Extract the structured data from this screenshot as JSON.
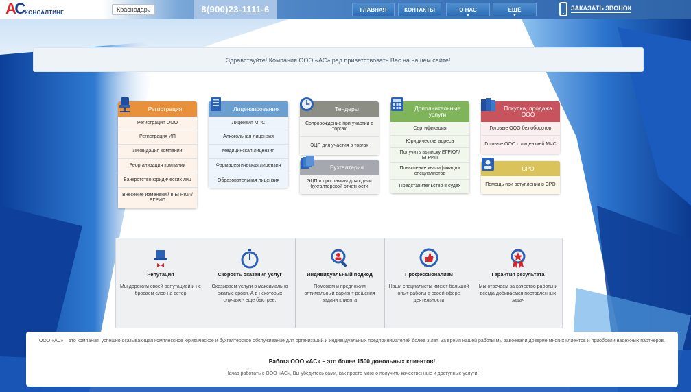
{
  "header": {
    "logo_mark": "АС",
    "logo_text": "КОНСАЛТИНГ",
    "city": "Краснодар",
    "phone": "8(900)23-1111-6",
    "nav": [
      {
        "label": "ГЛАВНАЯ",
        "dropdown": false
      },
      {
        "label": "КОНТАКТЫ",
        "dropdown": false
      },
      {
        "label": "О НАС",
        "dropdown": true
      },
      {
        "label": "ЕЩЁ",
        "dropdown": true
      }
    ],
    "callback_label": "ЗАКАЗАТЬ ЗВОНОК",
    "dropdown_glyph": "▼"
  },
  "welcome_text": "Здравствуйте! Компания ООО «АС» рад приветствовать Вас на нашем сайте!",
  "cards": {
    "registration": {
      "title": "Регистрация",
      "color": "#e8913a",
      "items": [
        "Регистрация ООО",
        "Регистрация ИП",
        "Ликвидация компании",
        "Реорганизация компании",
        "Банкротство юридических лиц",
        "Внесение изменений в ЕГРЮЛ/ЕГРИП"
      ]
    },
    "licensing": {
      "title": "Лицензирование",
      "color": "#6a9fd0",
      "items": [
        "Лицензия МЧС",
        "Алкогольная лицензия",
        "Медицинская лицензия",
        "Фармацевтическая лицензия",
        "Образовательная лицензия"
      ]
    },
    "tenders": {
      "title": "Тендеры",
      "color": "#8c8e85",
      "items": [
        "Сопровождение при участии в торгах",
        "ЭЦП для участия в торгах"
      ]
    },
    "accounting": {
      "title": "Бухгалтерия",
      "color": "#a5a8ae",
      "items": [
        "ЭЦП и программы для сдачи бухгалтерской отчетности"
      ]
    },
    "additional": {
      "title": "Дополнительные услуги",
      "color": "#7fb45a",
      "items": [
        "Сертификация",
        "Юридические адреса",
        "Получить выписку ЕГРЮЛ/ЕГРИП",
        "Повышение квалификации специалистов",
        "Представительство в судах"
      ]
    },
    "sale": {
      "title": "Покупка, продажа ООО",
      "color": "#c7545c",
      "items": [
        "Готовые ООО без оборотов",
        "Готовые ООО с лицензией МЧС"
      ]
    },
    "sro": {
      "title": "СРО",
      "color": "#d9c35a",
      "items": [
        "Помощь при вступлении в СРО"
      ]
    }
  },
  "features": [
    {
      "title": "Репутация",
      "text": "Мы дорожим своей репутацией и не бросаем слов на ветер",
      "icon": "top-hat-icon"
    },
    {
      "title": "Скорость оказания услуг",
      "text": "Оказываем услуги в максимально сжатые сроки. А в некоторых случаях - еще быстрее.",
      "icon": "stopwatch-icon"
    },
    {
      "title": "Индивидуальный подход",
      "text": "Поможем и предложим оптимальный вариант решения задачи клиента",
      "icon": "magnifier-person-icon"
    },
    {
      "title": "Профессионализм",
      "text": "Наши специалисты имеют большой опыт работы в своей сфере деятельности",
      "icon": "thumbs-up-icon"
    },
    {
      "title": "Гарантия результата",
      "text": "Мы отвечаем за качество работы и всегда добиваемся поставленных задач",
      "icon": "award-icon"
    }
  ],
  "bottom": {
    "about": "ООО «АС» – это компания, успешно оказывающая комплексное юридическое и бухгалтерское обслуживание для организаций и индивидуальных предпринимателей более 3 лет. За время нашей работы мы завоевали доверие многих клиентов и приобрели надежных партнеров.",
    "highlight": "Работа ООО «АС» – это более 1500 довольных клиентов!",
    "cta": "Начав работать с ООО «АС», Вы убедитесь сами, как просто можно получить качественные и доступные услуги!"
  }
}
